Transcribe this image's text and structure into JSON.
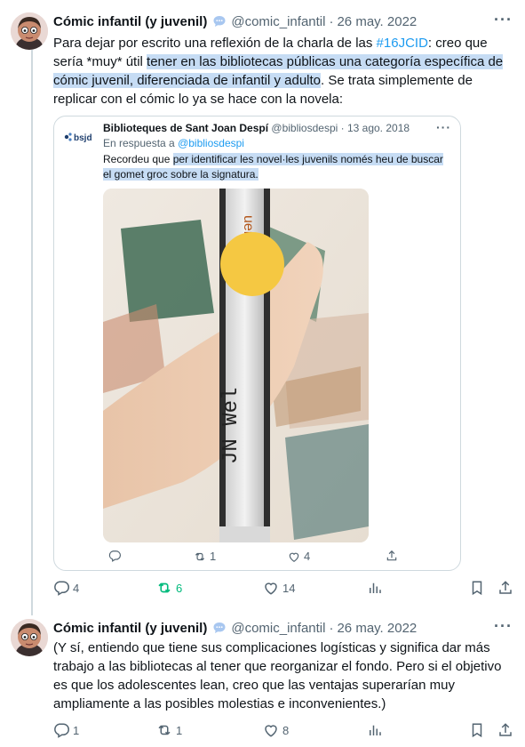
{
  "tweet1": {
    "author_name": "Cómic infantil (y juvenil)",
    "handle": "@comic_infantil",
    "dot": "·",
    "date": "26 may. 2022",
    "text_1": "Para dejar por escrito una reflexión de la charla de las ",
    "hashtag": "#16JCID",
    "text_2": ": creo que sería *muy* útil ",
    "highlight": "tener en las bibliotecas públicas una categoría específica de cómic juvenil, diferenciada de infantil y adulto",
    "text_3": ". Se trata  simplemente de replicar con el cómic lo ya se hace con la novela:",
    "stats": {
      "replies": "4",
      "retweets": "6",
      "likes": "14"
    }
  },
  "quote": {
    "logo_text": "bsjd",
    "author_name": "Biblioteques de Sant Joan Despí",
    "handle": "@bibliosdespi",
    "dot": "·",
    "date": "13 ago. 2018",
    "reply_prefix": "En respuesta a ",
    "reply_to": "@bibliosdespi",
    "text_1": "Recordeu que ",
    "highlight": "per identificar les novel·les juvenils només heu de buscar el gomet groc sobre la signatura.",
    "photo_spine_label": "JN Wel",
    "photo_spine_top": "uerr",
    "stats": {
      "retweets": "1",
      "likes": "4"
    }
  },
  "tweet2": {
    "author_name": "Cómic infantil (y juvenil)",
    "handle": "@comic_infantil",
    "dot": "·",
    "date": "26 may. 2022",
    "text": "(Y sí, entiendo que tiene sus complicaciones logísticas y significa dar más trabajo a las bibliotecas al tener que reorganizar el fondo. Pero si el objetivo es que los adolescentes lean, creo que las ventajas superarían muy ampliamente a las posibles molestias e inconvenientes.)",
    "stats": {
      "replies": "1",
      "retweets": "1",
      "likes": "8"
    }
  },
  "more_icon": "···",
  "colors": {
    "link": "#1d9bf0",
    "secondary": "#536471",
    "retweet_active": "#00ba7c",
    "highlight": "#c6dcf4",
    "sticker": "#f5c842"
  }
}
